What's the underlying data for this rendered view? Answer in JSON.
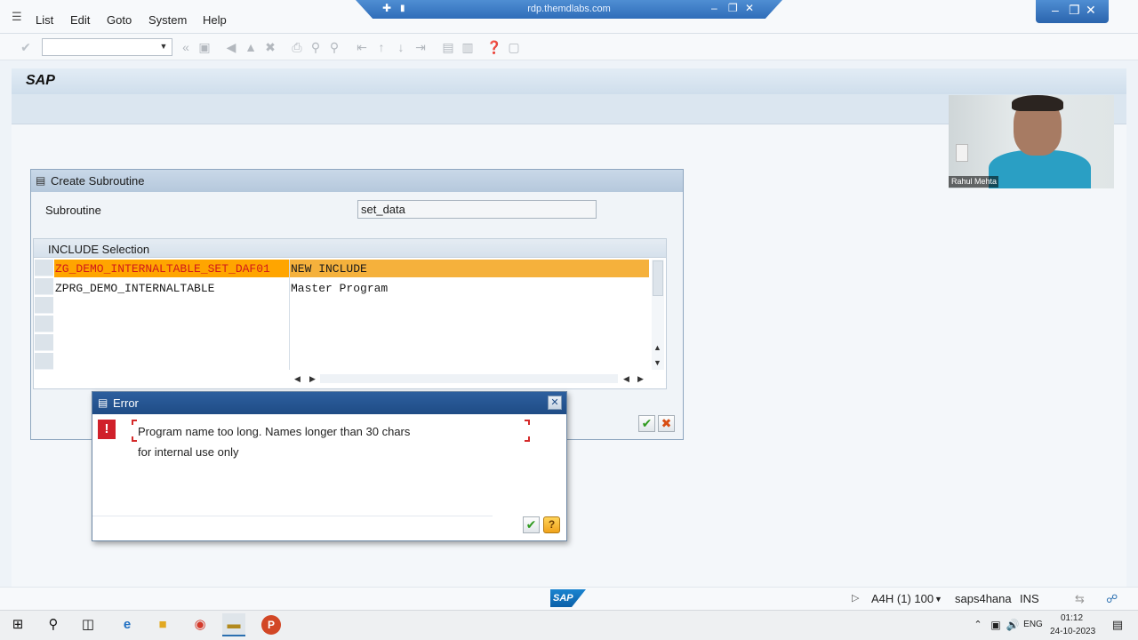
{
  "menu": {
    "items": [
      "List",
      "Edit",
      "Goto",
      "System",
      "Help"
    ]
  },
  "rdp": {
    "title": "rdp.themdlabs.com"
  },
  "sap_header": {
    "title": "SAP"
  },
  "webcam": {
    "label": "Rahul Mehta"
  },
  "create_dialog": {
    "title": "Create Subroutine",
    "subroutine_label": "Subroutine",
    "subroutine_value": "set_data",
    "include_title": "INCLUDE Selection",
    "rows": [
      {
        "name": "ZG_DEMO_INTERNALTABLE_SET_DAF01",
        "description": "NEW INCLUDE"
      },
      {
        "name": "ZPRG_DEMO_INTERNALTABLE",
        "description": "Master Program"
      }
    ]
  },
  "error_dialog": {
    "title": "Error",
    "message_line1": "Program name too long. Names longer than 30 chars",
    "message_line2": "for internal use only"
  },
  "status_bar": {
    "system": "A4H (1) 100",
    "server": "saps4hana",
    "mode": "INS",
    "logo": "SAP"
  },
  "taskbar": {
    "language": "ENG",
    "time": "01:12",
    "date": "24-10-2023"
  },
  "colors": {
    "selected_row": "#ffa500",
    "error_title": "#1f4c86",
    "ok_green": "#2f9a1e",
    "cancel_red": "#d84d12"
  }
}
